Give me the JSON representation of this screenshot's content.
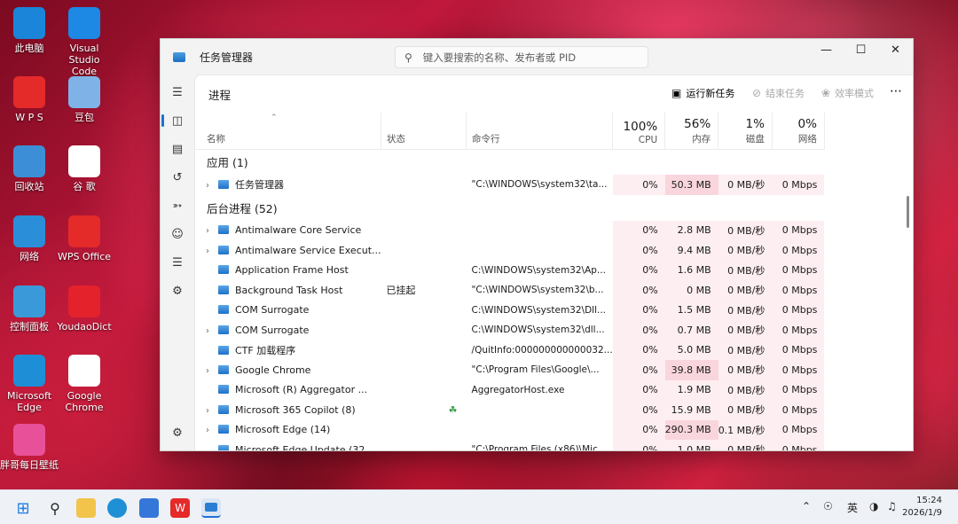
{
  "desktop": {
    "icons": [
      {
        "label": "此电脑",
        "icon": "this-pc-icon",
        "color": "#1b86d9"
      },
      {
        "label": "Visual Studio Code",
        "icon": "vscode-icon",
        "color": "#1e88e5"
      },
      {
        "label": "W P S",
        "icon": "wps-icon",
        "color": "#e52a2a"
      },
      {
        "label": "豆包",
        "icon": "doubao-icon",
        "color": "#7fb3e8"
      },
      {
        "label": "回收站",
        "icon": "recycle-bin-icon",
        "color": "#3c8fd6"
      },
      {
        "label": "谷 歌",
        "icon": "chrome-icon",
        "color": "#ffffff"
      },
      {
        "label": "网络",
        "icon": "network-icon",
        "color": "#2a8fd8"
      },
      {
        "label": "WPS Office",
        "icon": "wps-office-icon",
        "color": "#e52a2a"
      },
      {
        "label": "控制面板",
        "icon": "control-panel-icon",
        "color": "#3a9ad9"
      },
      {
        "label": "YoudaoDict",
        "icon": "youdao-icon",
        "color": "#e4222c"
      },
      {
        "label": "Microsoft Edge",
        "icon": "edge-icon",
        "color": "#1e8fd6"
      },
      {
        "label": "Google Chrome",
        "icon": "chrome-icon",
        "color": "#ffffff"
      },
      {
        "label": "胖哥每日壁纸",
        "icon": "wallpaper-app-icon",
        "color": "#e8509a"
      }
    ]
  },
  "window": {
    "title": "任务管理器",
    "search_placeholder": "键入要搜索的名称、发布者或 PID",
    "page_title": "进程",
    "commands": {
      "run_new_task": "运行新任务",
      "end_task": "结束任务",
      "efficiency_mode": "效率模式"
    },
    "columns": {
      "name": "名称",
      "status": "状态",
      "command_line": "命令行",
      "cpu_pct": "100%",
      "cpu": "CPU",
      "mem_pct": "56%",
      "mem": "内存",
      "disk_pct": "1%",
      "disk": "磁盘",
      "net_pct": "0%",
      "net": "网络"
    },
    "groups": {
      "apps": "应用 (1)",
      "background": "后台进程 (52)"
    },
    "app_rows": [
      {
        "name": "任务管理器",
        "expandable": true,
        "status": "",
        "cmd": "\"C:\\WINDOWS\\system32\\ta...",
        "cpu": "0%",
        "mem": "50.3 MB",
        "disk": "0 MB/秒",
        "net": "0 Mbps",
        "memHeat": "h2"
      }
    ],
    "bg_rows": [
      {
        "name": "Antimalware Core Service",
        "expandable": true,
        "status": "",
        "cmd": "",
        "cpu": "0%",
        "mem": "2.8 MB",
        "disk": "0 MB/秒",
        "net": "0 Mbps",
        "memHeat": "h1"
      },
      {
        "name": "Antimalware Service Execut...",
        "expandable": true,
        "status": "",
        "cmd": "",
        "cpu": "0%",
        "mem": "9.4 MB",
        "disk": "0 MB/秒",
        "net": "0 Mbps",
        "memHeat": "h1"
      },
      {
        "name": "Application Frame Host",
        "expandable": false,
        "status": "",
        "cmd": "C:\\WINDOWS\\system32\\Ap...",
        "cpu": "0%",
        "mem": "1.6 MB",
        "disk": "0 MB/秒",
        "net": "0 Mbps",
        "memHeat": "h1"
      },
      {
        "name": "Background Task Host",
        "expandable": false,
        "status": "已挂起",
        "cmd": "\"C:\\WINDOWS\\system32\\b...",
        "cpu": "0%",
        "mem": "0 MB",
        "disk": "0 MB/秒",
        "net": "0 Mbps",
        "memHeat": "h1"
      },
      {
        "name": "COM Surrogate",
        "expandable": false,
        "status": "",
        "cmd": "C:\\WINDOWS\\system32\\Dll...",
        "cpu": "0%",
        "mem": "1.5 MB",
        "disk": "0 MB/秒",
        "net": "0 Mbps",
        "memHeat": "h1"
      },
      {
        "name": "COM Surrogate",
        "expandable": true,
        "status": "",
        "cmd": "C:\\WINDOWS\\system32\\dll...",
        "cpu": "0%",
        "mem": "0.7 MB",
        "disk": "0 MB/秒",
        "net": "0 Mbps",
        "memHeat": "h1"
      },
      {
        "name": "CTF 加载程序",
        "expandable": false,
        "status": "",
        "cmd": "/QuitInfo:000000000000032...",
        "cpu": "0%",
        "mem": "5.0 MB",
        "disk": "0 MB/秒",
        "net": "0 Mbps",
        "memHeat": "h1"
      },
      {
        "name": "Google Chrome",
        "expandable": true,
        "status": "",
        "cmd": "\"C:\\Program Files\\Google\\...",
        "cpu": "0%",
        "mem": "39.8 MB",
        "disk": "0 MB/秒",
        "net": "0 Mbps",
        "memHeat": "h2"
      },
      {
        "name": "Microsoft (R) Aggregator ...",
        "expandable": false,
        "status": "",
        "cmd": "AggregatorHost.exe",
        "cpu": "0%",
        "mem": "1.9 MB",
        "disk": "0 MB/秒",
        "net": "0 Mbps",
        "memHeat": "h1"
      },
      {
        "name": "Microsoft 365 Copilot (8)",
        "expandable": true,
        "status": "",
        "cmd": "",
        "cpu": "0%",
        "mem": "15.9 MB",
        "disk": "0 MB/秒",
        "net": "0 Mbps",
        "memHeat": "h1",
        "leaf": true
      },
      {
        "name": "Microsoft Edge (14)",
        "expandable": true,
        "status": "",
        "cmd": "",
        "cpu": "0%",
        "mem": "290.3 MB",
        "disk": "0.1 MB/秒",
        "net": "0 Mbps",
        "memHeat": "h2"
      },
      {
        "name": "Microsoft Edge Update (32...",
        "expandable": false,
        "status": "",
        "cmd": "\"C:\\Program Files (x86)\\Mic...",
        "cpu": "0%",
        "mem": "1.0 MB",
        "disk": "0 MB/秒",
        "net": "0 Mbps",
        "memHeat": "h1"
      }
    ]
  },
  "taskbar": {
    "ime": "英",
    "time": "15:24",
    "date": "2026/1/9"
  },
  "colors": {
    "accent": "#1f6fd6",
    "heat_light": "#fdeef1",
    "heat_strong": "#f9d6dd"
  }
}
